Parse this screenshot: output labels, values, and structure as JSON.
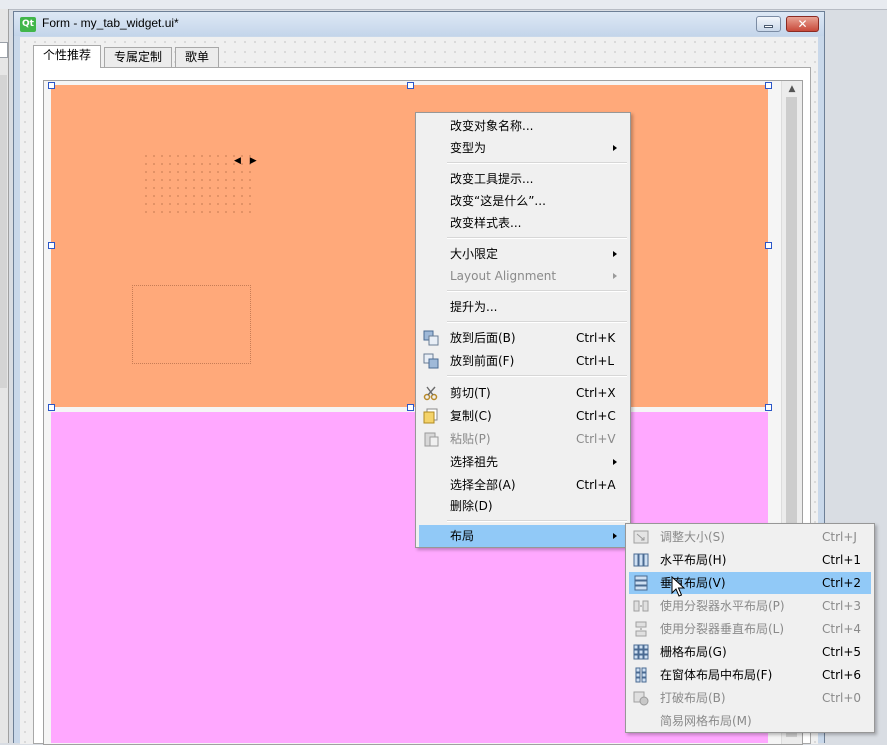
{
  "window": {
    "title": "Form - my_tab_widget.ui*",
    "logo_text": "Qt",
    "close_glyph": "✕"
  },
  "tabs": [
    {
      "label": "个性推荐",
      "active": true
    },
    {
      "label": "专属定制",
      "active": false
    },
    {
      "label": "歌单",
      "active": false
    }
  ],
  "widgets": {
    "top_color": "#ffa97a",
    "bottom_color": "#ffa8ff",
    "arrows": "◀ ▶"
  },
  "context_menu": {
    "items": [
      {
        "label": "改变对象名称...",
        "shortcut": "",
        "submenu": false,
        "disabled": false,
        "icon": ""
      },
      {
        "label": "变型为",
        "shortcut": "",
        "submenu": true,
        "disabled": false,
        "icon": ""
      },
      {
        "label": "改变工具提示...",
        "shortcut": "",
        "submenu": false,
        "disabled": false,
        "icon": ""
      },
      {
        "label": "改变“这是什么”...",
        "shortcut": "",
        "submenu": false,
        "disabled": false,
        "icon": ""
      },
      {
        "label": "改变样式表...",
        "shortcut": "",
        "submenu": false,
        "disabled": false,
        "icon": ""
      },
      {
        "label": "大小限定",
        "shortcut": "",
        "submenu": true,
        "disabled": false,
        "icon": ""
      },
      {
        "label": "Layout Alignment",
        "shortcut": "",
        "submenu": true,
        "disabled": true,
        "icon": ""
      },
      {
        "label": "提升为...",
        "shortcut": "",
        "submenu": false,
        "disabled": false,
        "icon": ""
      },
      {
        "label": "放到后面(B)",
        "shortcut": "Ctrl+K",
        "submenu": false,
        "disabled": false,
        "icon": "send-to-back-icon"
      },
      {
        "label": "放到前面(F)",
        "shortcut": "Ctrl+L",
        "submenu": false,
        "disabled": false,
        "icon": "bring-to-front-icon"
      },
      {
        "label": "剪切(T)",
        "shortcut": "Ctrl+X",
        "submenu": false,
        "disabled": false,
        "icon": "scissors-icon"
      },
      {
        "label": "复制(C)",
        "shortcut": "Ctrl+C",
        "submenu": false,
        "disabled": false,
        "icon": "copy-icon"
      },
      {
        "label": "粘贴(P)",
        "shortcut": "Ctrl+V",
        "submenu": false,
        "disabled": true,
        "icon": "paste-icon"
      },
      {
        "label": "选择祖先",
        "shortcut": "",
        "submenu": true,
        "disabled": false,
        "icon": ""
      },
      {
        "label": "选择全部(A)",
        "shortcut": "Ctrl+A",
        "submenu": false,
        "disabled": false,
        "icon": ""
      },
      {
        "label": "删除(D)",
        "shortcut": "",
        "submenu": false,
        "disabled": false,
        "icon": ""
      },
      {
        "label": "布局",
        "shortcut": "",
        "submenu": true,
        "disabled": false,
        "icon": "",
        "highlighted": true
      }
    ]
  },
  "layout_submenu": {
    "items": [
      {
        "label": "调整大小(S)",
        "shortcut": "Ctrl+J",
        "disabled": true,
        "icon": "adjust-size-icon"
      },
      {
        "label": "水平布局(H)",
        "shortcut": "Ctrl+1",
        "disabled": false,
        "icon": "horizontal-layout-icon"
      },
      {
        "label": "垂直布局(V)",
        "shortcut": "Ctrl+2",
        "disabled": false,
        "icon": "vertical-layout-icon",
        "highlighted": true
      },
      {
        "label": "使用分裂器水平布局(P)",
        "shortcut": "Ctrl+3",
        "disabled": true,
        "icon": "horizontal-splitter-icon"
      },
      {
        "label": "使用分裂器垂直布局(L)",
        "shortcut": "Ctrl+4",
        "disabled": true,
        "icon": "vertical-splitter-icon"
      },
      {
        "label": "栅格布局(G)",
        "shortcut": "Ctrl+5",
        "disabled": false,
        "icon": "grid-layout-icon"
      },
      {
        "label": "在窗体布局中布局(F)",
        "shortcut": "Ctrl+6",
        "disabled": false,
        "icon": "form-layout-icon"
      },
      {
        "label": "打破布局(B)",
        "shortcut": "Ctrl+0",
        "disabled": true,
        "icon": "break-layout-icon"
      },
      {
        "label": "简易网格布局(M)",
        "shortcut": "",
        "disabled": true,
        "icon": ""
      }
    ]
  }
}
